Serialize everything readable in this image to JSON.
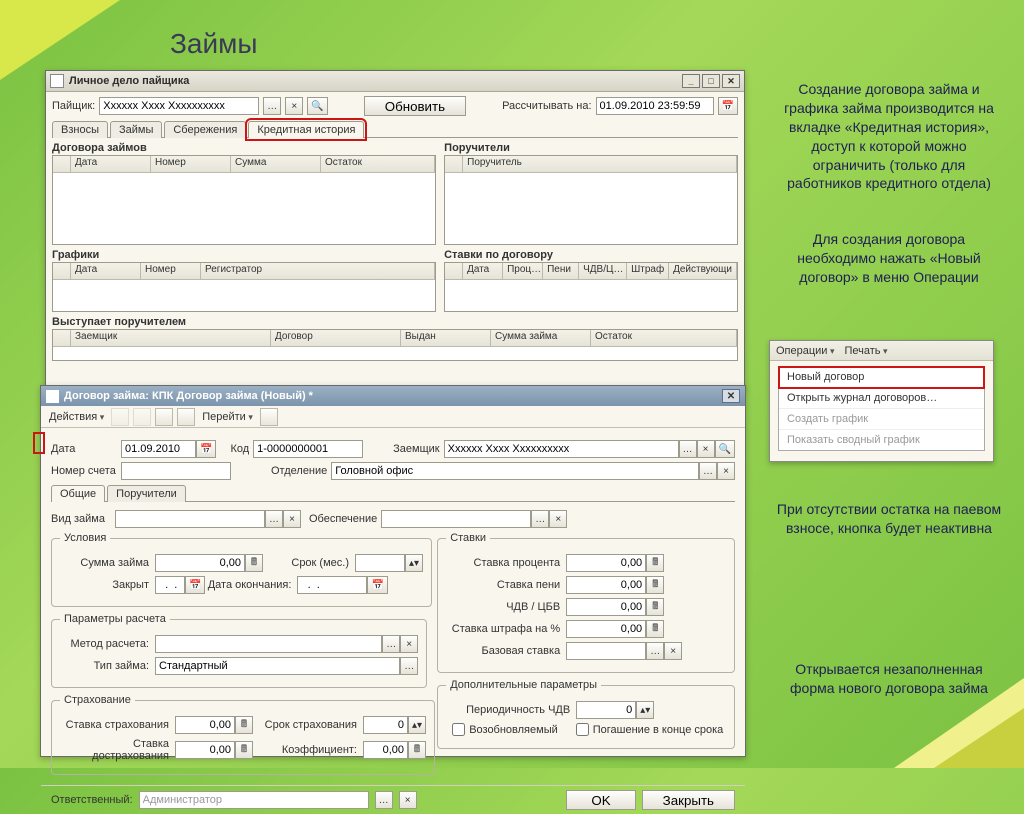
{
  "page": {
    "title": "Займы"
  },
  "side_notes": {
    "p1": "Создание договора займа и графика займа производится на вкладке «Кредитная история», доступ к которой можно ограничить (только для работников кредитного отдела)",
    "p2": "Для создания договора необходимо нажать «Новый договор» в меню Операции",
    "p3": "При отсутствии остатка на паевом взносе, кнопка будет неактивна",
    "p4": "Открывается незаполненная форма нового договора займа"
  },
  "win1": {
    "title": "Личное дело пайщика",
    "payshik_label": "Пайщик:",
    "payshik_value": "Хххххх Хххх Хххххххххх",
    "refresh": "Обновить",
    "calc_label": "Рассчитывать на:",
    "calc_value": "01.09.2010 23:59:59",
    "tabs": [
      "Взносы",
      "Займы",
      "Сбережения",
      "Кредитная история"
    ],
    "sec1": "Договора займов",
    "cols1": [
      "Дата",
      "Номер",
      "Сумма",
      "Остаток"
    ],
    "sec2": "Поручители",
    "cols2": [
      "Поручитель"
    ],
    "sec3": "Графики",
    "cols3": [
      "Дата",
      "Номер",
      "Регистратор"
    ],
    "sec4": "Ставки по договору",
    "cols4": [
      "Дата",
      "Проц…",
      "Пени",
      "ЧДВ/Ц…",
      "Штраф",
      "Действующи"
    ],
    "sec5": "Выступает поручителем",
    "cols5": [
      "Заемщик",
      "Договор",
      "Выдан",
      "Сумма займа",
      "Остаток"
    ]
  },
  "win2": {
    "title": "Договор займа: КПК Договор займа (Новый) *",
    "menu_actions": "Действия",
    "menu_go": "Перейти",
    "date_label": "Дата",
    "date_val": "01.09.2010",
    "code_label": "Код",
    "code_val": "1-0000000001",
    "borrower_label": "Заемщик",
    "borrower_val": "Хххххх Хххх Хххххххххх",
    "acct_label": "Номер счета",
    "dept_label": "Отделение",
    "dept_val": "Головной офис",
    "tabs": [
      "Общие",
      "Поручители"
    ],
    "loan_type_label": "Вид займа",
    "collateral_label": "Обеспечение",
    "fs_terms": "Условия",
    "sum_label": "Сумма займа",
    "sum_val": "0,00",
    "term_label": "Срок (мес.)",
    "closed_label": "Закрыт",
    "enddate_label": "Дата окончания:",
    "fs_calc": "Параметры расчета",
    "method_label": "Метод расчета:",
    "ltype_label": "Тип займа:",
    "ltype_val": "Стандартный",
    "fs_ins": "Страхование",
    "ins_rate_label": "Ставка страхования",
    "ins_rate_val": "0,00",
    "ins_term_label": "Срок страхования",
    "ins_term_val": "0",
    "ins_add_label": "Ставка дострахования",
    "ins_add_val": "0,00",
    "coef_label": "Коэффициент:",
    "coef_val": "0,00",
    "fs_rates": "Ставки",
    "pct_label": "Ставка процента",
    "pct_val": "0,00",
    "peni_label": "Ставка пени",
    "peni_val": "0,00",
    "chdv_label": "ЧДВ / ЦБВ",
    "chdv_val": "0,00",
    "fine_label": "Ставка штрафа на %",
    "fine_val": "0,00",
    "base_label": "Базовая ставка",
    "fs_extra": "Дополнительные параметры",
    "period_label": "Периодичность ЧДВ",
    "period_val": "0",
    "renew_label": "Возобновляемый",
    "repay_end_label": "Погашение в конце срока",
    "resp_label": "Ответственный:",
    "resp_val": "Администратор",
    "ok": "OK",
    "close": "Закрыть"
  },
  "ops_menu": {
    "top1": "Операции",
    "top2": "Печать",
    "items": [
      "Новый договор",
      "Открыть журнал договоров…",
      "Создать график",
      "Показать сводный график"
    ]
  }
}
